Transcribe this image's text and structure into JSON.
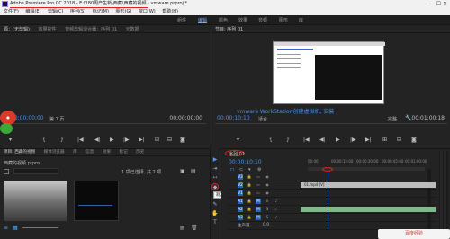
{
  "window": {
    "title": "Adobe Premiere Pro CC 2018 - E:\\180周产生新\\西藏\\西藏的视频 - vmware.prproj *"
  },
  "menu": [
    "文件(F)",
    "编辑(E)",
    "剪辑(C)",
    "序列(S)",
    "标记(M)",
    "图形(G)",
    "窗口(W)",
    "帮助(H)"
  ],
  "workspaces": [
    "组件",
    "编辑",
    "颜色",
    "效果",
    "音频",
    "图形",
    "库"
  ],
  "source_panel": {
    "tabs": [
      "源：(无剪辑)",
      "效果控件",
      "音频剪辑混合器：序列 01",
      "元数据"
    ],
    "timecode_left": "00;00;00;00",
    "page_label": "第 1 页",
    "timecode_right": "00;00;00;00"
  },
  "program_panel": {
    "title": "节目: 序列 01",
    "timecode": "00:00:10:10",
    "fit_label": "适合",
    "quality_label": "完整",
    "duration": "00:01:00:18",
    "caption": "vmware WorkStation创建虚拟机, 安装"
  },
  "project_panel": {
    "tabs": [
      "项目: 西藏的视频",
      "媒体浏览器",
      "库",
      "信息",
      "效果",
      "标记",
      "历史"
    ],
    "file": "西藏的视频.prproj",
    "items_count": "1 项已选择, 共 2 项"
  },
  "timeline": {
    "tab": "序列 01",
    "timecode": "00:00:10:10",
    "clip_name": "01.mp4 [V]",
    "ruler": [
      "00:00",
      "00:00:15:00",
      "00:00:30:00",
      "00:00:45:00",
      "00:01:00:00"
    ],
    "tracks": [
      {
        "name": "V3"
      },
      {
        "name": "V2"
      },
      {
        "name": "V1"
      },
      {
        "name": "A1"
      },
      {
        "name": "A2"
      },
      {
        "name": "A3"
      }
    ],
    "master_label": "主声道",
    "master_value": "0.0"
  },
  "tools": {
    "tooltip": "剃刀工具 (C)"
  },
  "watermark": "百度经验",
  "colors": {
    "accent": "#4a90e2",
    "highlight": "#e02020",
    "track_button": "#2d5fb5"
  }
}
